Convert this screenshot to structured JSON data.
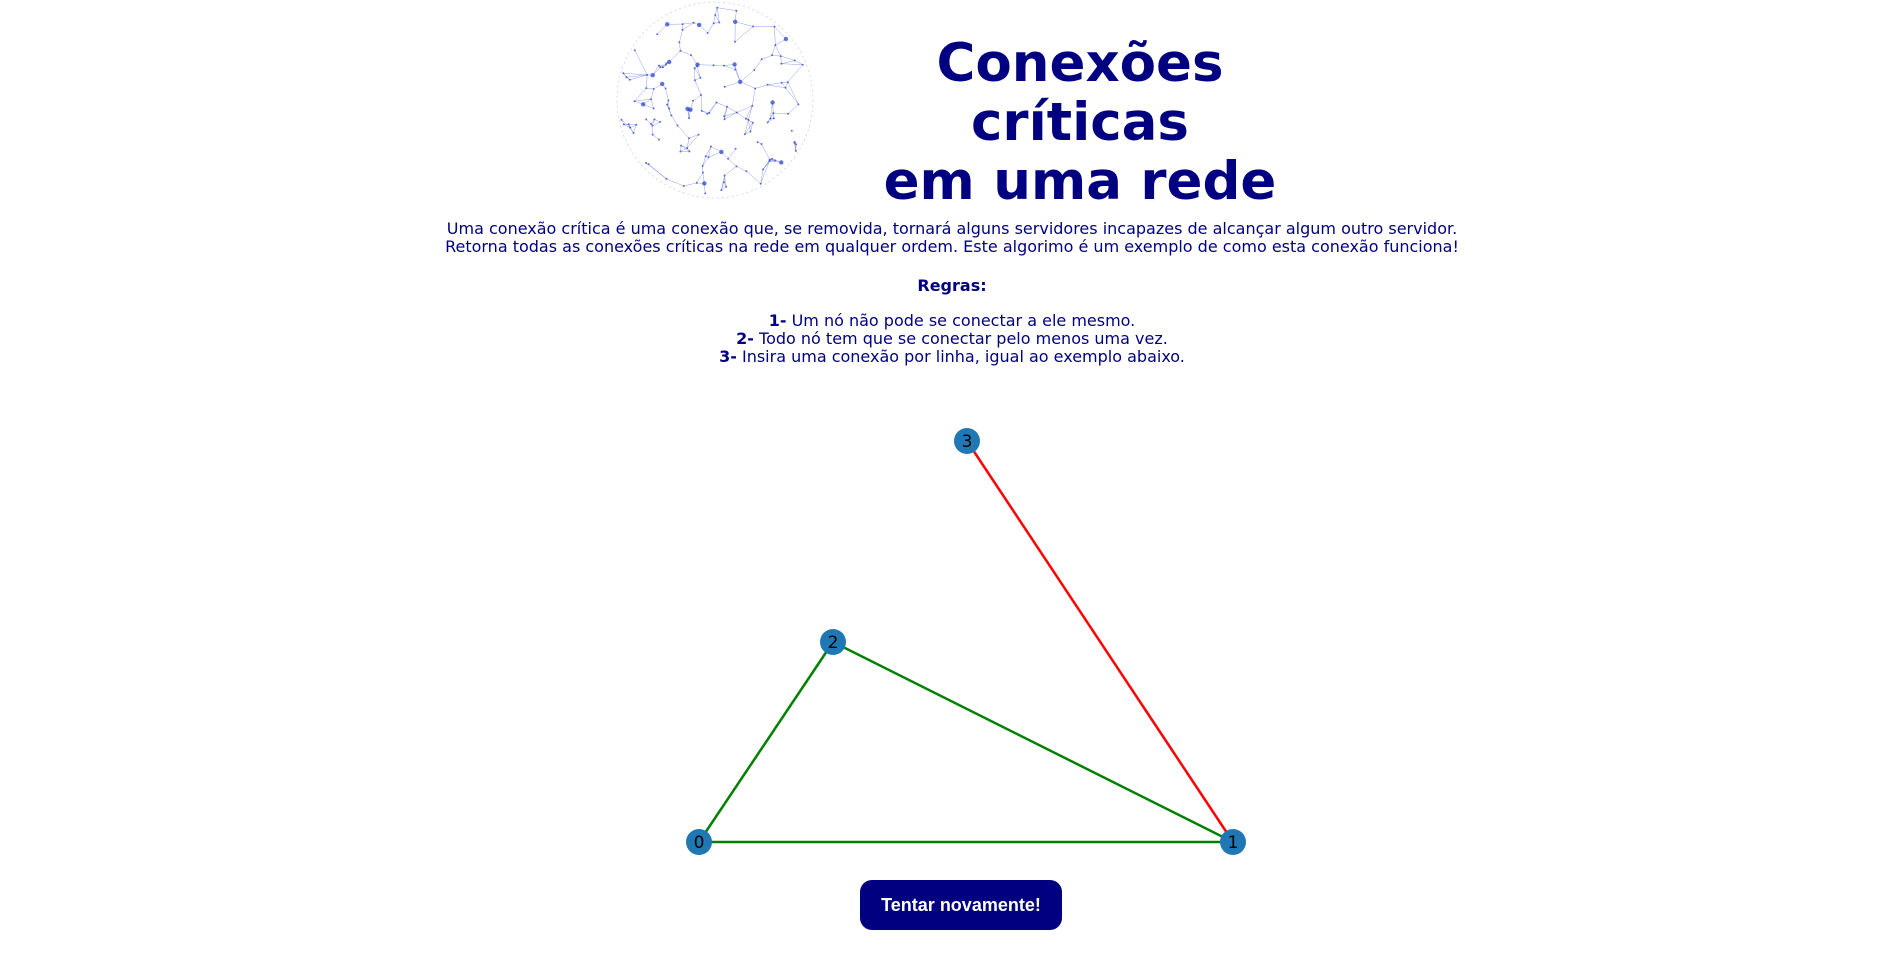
{
  "header": {
    "title_line1": "Conexões críticas",
    "title_line2": "em uma rede",
    "logo_icon": "network-globe-icon"
  },
  "description": {
    "line1": "Uma conexão crítica é uma conexão que, se removida, tornará alguns servidores incapazes de alcançar algum outro servidor.",
    "line2": "Retorna todas as conexões críticas na rede em qualquer ordem. Este algorimo é um exemplo de como esta conexão funciona!"
  },
  "rules": {
    "title": "Regras:",
    "items": [
      {
        "num": "1-",
        "text": " Um nó não pode se conectar a ele mesmo."
      },
      {
        "num": "2-",
        "text": " Todo nó tem que se conectar pelo menos uma vez."
      },
      {
        "num": "3-",
        "text": " Insira uma conexão por linha, igual ao exemplo abaixo."
      }
    ]
  },
  "graph": {
    "nodes": [
      {
        "id": "0",
        "label": "0"
      },
      {
        "id": "1",
        "label": "1"
      },
      {
        "id": "2",
        "label": "2"
      },
      {
        "id": "3",
        "label": "3"
      }
    ],
    "edges": [
      {
        "from": "0",
        "to": "1",
        "critical": false
      },
      {
        "from": "0",
        "to": "2",
        "critical": false
      },
      {
        "from": "2",
        "to": "1",
        "critical": false
      },
      {
        "from": "3",
        "to": "1",
        "critical": true
      }
    ],
    "colors": {
      "node": "#1f78b4",
      "edge_normal": "#008000",
      "edge_critical": "#ff0000",
      "label": "#000000"
    }
  },
  "actions": {
    "retry_label": "Tentar novamente!"
  },
  "theme": {
    "primary": "#000080",
    "globe": "#3a4fd0"
  }
}
